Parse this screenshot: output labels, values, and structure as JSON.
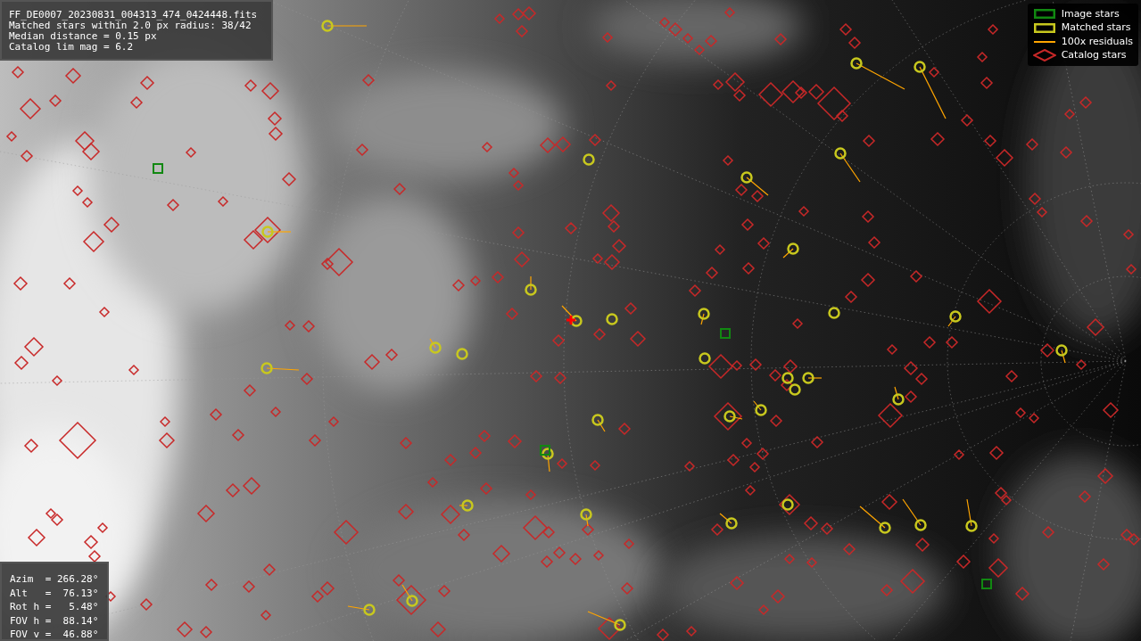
{
  "info_panel": {
    "lines": [
      "FF_DE0007_20230831_004313_474_0424448.fits",
      "Matched stars within 2.0 px radius: 38/42",
      "Median distance = 0.15 px",
      "Catalog lim mag = 6.2"
    ]
  },
  "legend": {
    "items": [
      {
        "label": "Image stars",
        "color": "#118811"
      },
      {
        "kind": "matched",
        "label": "Matched stars",
        "color": "#c8c81e"
      },
      {
        "kind": "residual",
        "label": "100x residuals",
        "color": "#ffa500"
      },
      {
        "kind": "catalog",
        "label": "Catalog stars",
        "color": "#c82828"
      }
    ]
  },
  "pointing_panel": {
    "lines": [
      "Azim  = 266.28°",
      "Alt   =  76.13°",
      "Rot h =   5.48°",
      "FOV h =  88.14°",
      "FOV v =  46.88°"
    ]
  }
}
